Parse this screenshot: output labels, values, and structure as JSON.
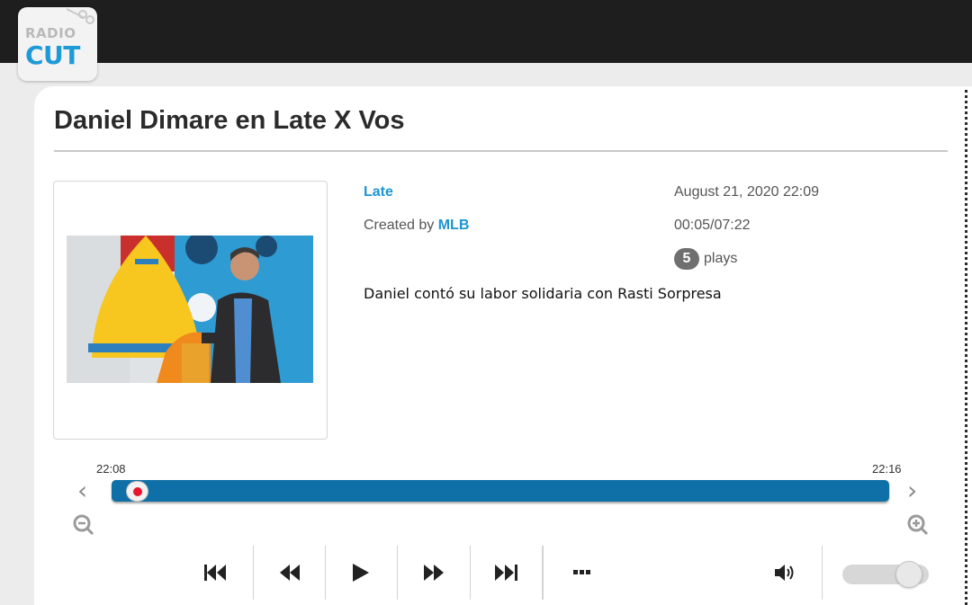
{
  "header": {
    "logo_top": "RADIO",
    "logo_bottom": "CUT"
  },
  "clip": {
    "title": "Daniel Dimare en Late X Vos",
    "program_link": "Late",
    "created_by_prefix": "Created by",
    "creator_link": "MLB",
    "datetime": "August 21, 2020 22:09",
    "position": "00:05",
    "separator": "/",
    "duration": "07:22",
    "plays_count": "5",
    "plays_label": "plays",
    "description": "Daniel contó su labor solidaria con Rasti Sorpresa",
    "thumbnail_icon": "clip-thumbnail-photo"
  },
  "timeline": {
    "start_label": "22:08",
    "end_label": "22:16",
    "playhead_fraction": 0.01,
    "left_arrow_icon": "chevron-left-icon",
    "right_arrow_icon": "chevron-right-icon",
    "zoom_out_icon": "zoom-out-icon",
    "zoom_in_icon": "zoom-in-icon"
  },
  "player": {
    "buttons": [
      "skip-start-icon",
      "rewind-icon",
      "play-icon",
      "fast-forward-icon",
      "skip-end-icon",
      "more-icon",
      "volume-icon"
    ],
    "volume_level": 0.9
  },
  "colors": {
    "accent": "#1c95d2",
    "track": "#0f70a8",
    "playhead": "#e8152d",
    "topbar": "#1e1e1e"
  }
}
